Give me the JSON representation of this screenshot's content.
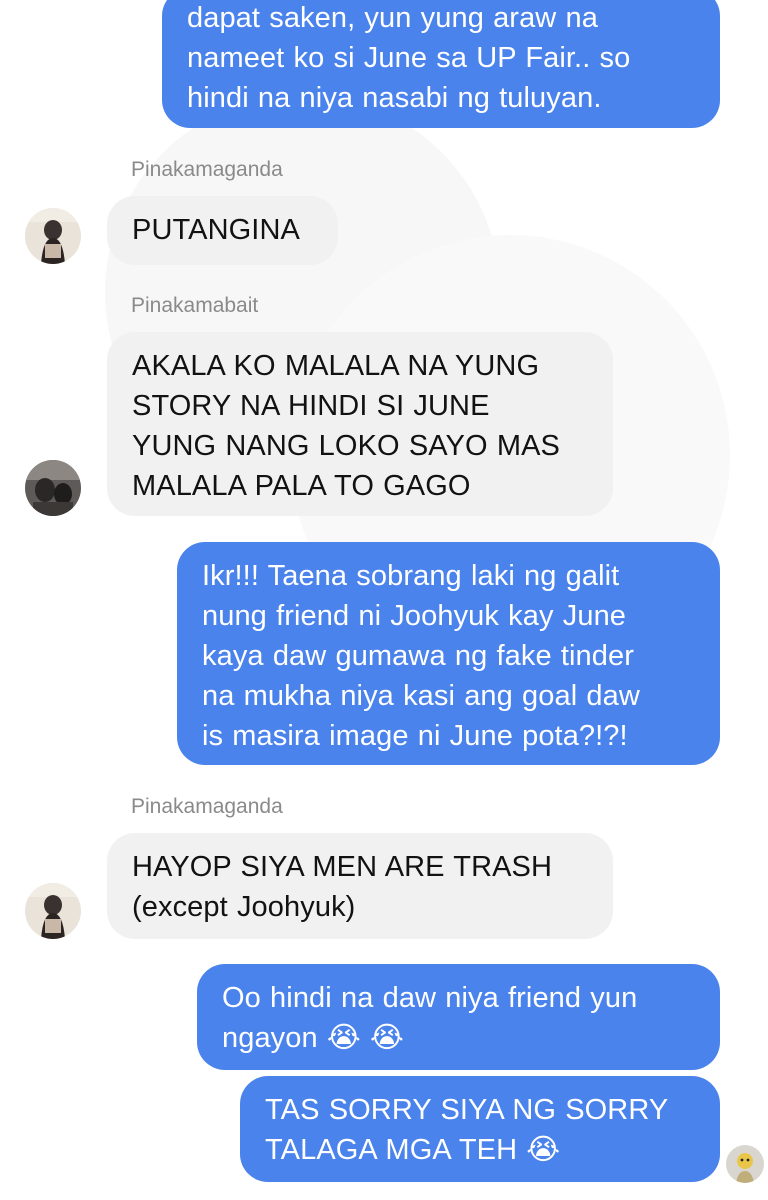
{
  "colors": {
    "outgoing_bubble": "#4a83ec",
    "incoming_bubble": "#f1f1f1",
    "sender_name": "#8a8a8a",
    "background": "#ffffff"
  },
  "messages": [
    {
      "direction": "outgoing",
      "lines": [
        "dapat saken, yun yung araw na",
        "nameet ko si June sa UP Fair.. so",
        "hindi na niya nasabi ng tuluyan."
      ]
    },
    {
      "direction": "incoming",
      "sender": "Pinakamaganda",
      "avatar": "avatar-pinakamaganda",
      "lines": [
        "PUTANGINA"
      ]
    },
    {
      "direction": "incoming",
      "sender": "Pinakamabait",
      "avatar": "avatar-pinakamabait",
      "lines": [
        "AKALA KO MALALA NA YUNG",
        "STORY NA HINDI SI JUNE",
        "YUNG NANG LOKO SAYO MAS",
        "MALALA PALA TO GAGO"
      ]
    },
    {
      "direction": "outgoing",
      "lines": [
        "Ikr!!! Taena sobrang laki ng galit",
        "nung friend ni Joohyuk kay June",
        "kaya daw gumawa ng fake tinder",
        "na mukha niya kasi ang goal daw",
        "is masira image ni June pota?!?!"
      ]
    },
    {
      "direction": "incoming",
      "sender": "Pinakamaganda",
      "avatar": "avatar-pinakamaganda",
      "lines": [
        "HAYOP SIYA MEN ARE TRASH",
        "(except Joohyuk)"
      ]
    },
    {
      "direction": "outgoing",
      "lines": [
        "Oo hindi na daw niya friend yun",
        "ngayon 😭 😭"
      ]
    },
    {
      "direction": "outgoing",
      "lines": [
        "TAS SORRY SIYA NG SORRY",
        "TALAGA MGA TEH 😭"
      ]
    }
  ]
}
